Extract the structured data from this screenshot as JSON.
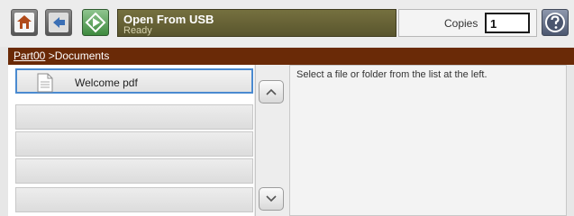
{
  "header": {
    "home_icon": "home-icon",
    "back_icon": "back-arrow-icon",
    "usb_icon": "usb-start-icon",
    "title": "Open From USB",
    "status": "Ready",
    "copies_label": "Copies",
    "copies_value": "1",
    "help_icon": "help-icon"
  },
  "breadcrumb": {
    "root": "Part00",
    "separator": " >",
    "current": "Documents"
  },
  "file_list": {
    "items": [
      {
        "label": "Welcome pdf",
        "icon": "document-icon",
        "selected": true
      },
      {
        "label": ""
      },
      {
        "label": ""
      },
      {
        "label": ""
      },
      {
        "label": ""
      }
    ]
  },
  "scrollbar": {
    "up_icon": "chevron-up-icon",
    "down_icon": "chevron-down-icon"
  },
  "details": {
    "text": "Select a file or folder from the list at the left."
  },
  "colors": {
    "breadcrumb_bg": "#6a2a07",
    "status_bg": "#5f5a33",
    "selection_border": "#4a8ad0",
    "usb_button": "#3e8a3e"
  }
}
